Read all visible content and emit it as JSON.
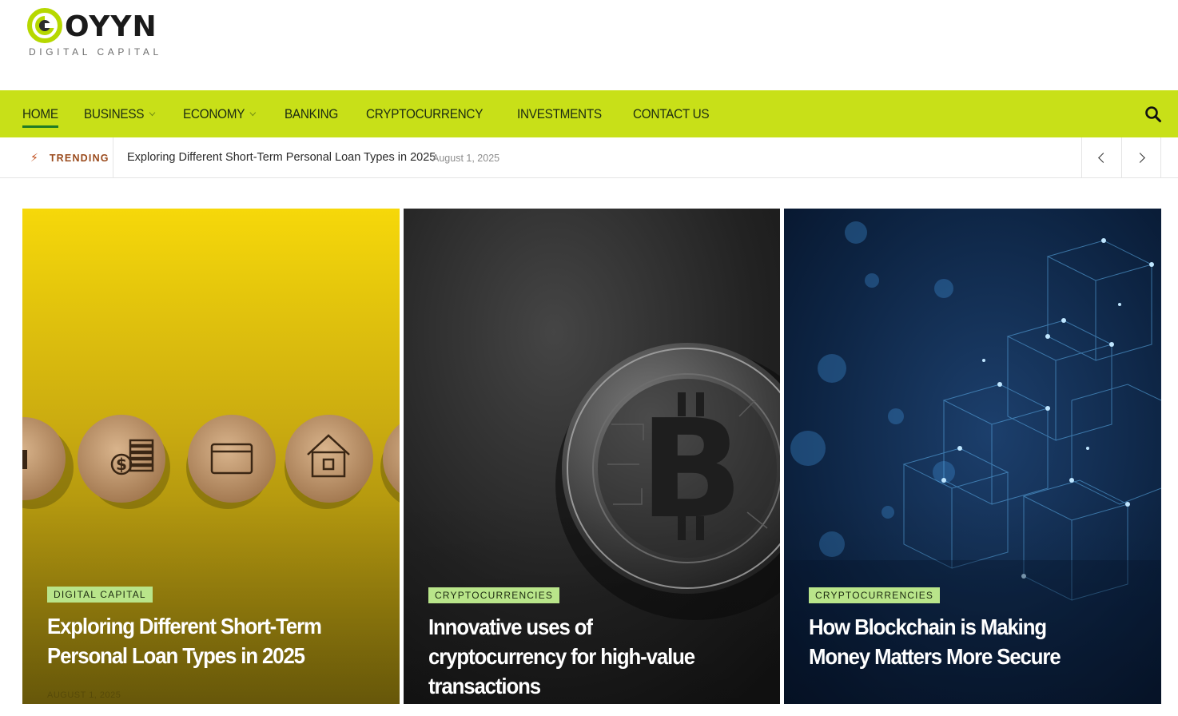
{
  "brand": {
    "name": "OYYN",
    "tagline": "DIGITAL CAPITAL",
    "accent": "#c8e018"
  },
  "nav": {
    "items": [
      {
        "label": "HOME",
        "active": true,
        "has_dropdown": false
      },
      {
        "label": "BUSINESS",
        "active": false,
        "has_dropdown": true
      },
      {
        "label": "ECONOMY",
        "active": false,
        "has_dropdown": true
      },
      {
        "label": "BANKING",
        "active": false,
        "has_dropdown": false
      },
      {
        "label": "CRYPTOCURRENCY",
        "active": false,
        "has_dropdown": false
      },
      {
        "label": "INVESTMENTS",
        "active": false,
        "has_dropdown": false
      },
      {
        "label": "CONTACT US",
        "active": false,
        "has_dropdown": false
      }
    ],
    "search_icon": "search-icon"
  },
  "trending": {
    "label": "TRENDING",
    "icon": "bolt-icon",
    "title": "Exploring Different Short-Term Personal Loan Types in 2025",
    "date": "August 1, 2025",
    "prev_icon": "chevron-left-icon",
    "next_icon": "chevron-right-icon"
  },
  "cards": [
    {
      "category": "DIGITAL CAPITAL",
      "title": "Exploring Different Short-Term Personal Loan Types in 2025",
      "date": "AUGUST 1, 2025",
      "image": "wooden-coins-with-finance-icons-on-yellow"
    },
    {
      "category": "CRYPTOCURRENCIES",
      "title": "Innovative uses of cryptocurrency for high-value transactions",
      "image": "bitcoin-coin-on-dark-background"
    },
    {
      "category": "CRYPTOCURRENCIES",
      "title": "How Blockchain is Making Money Matters More Secure",
      "image": "blue-blockchain-network-cubes"
    }
  ]
}
